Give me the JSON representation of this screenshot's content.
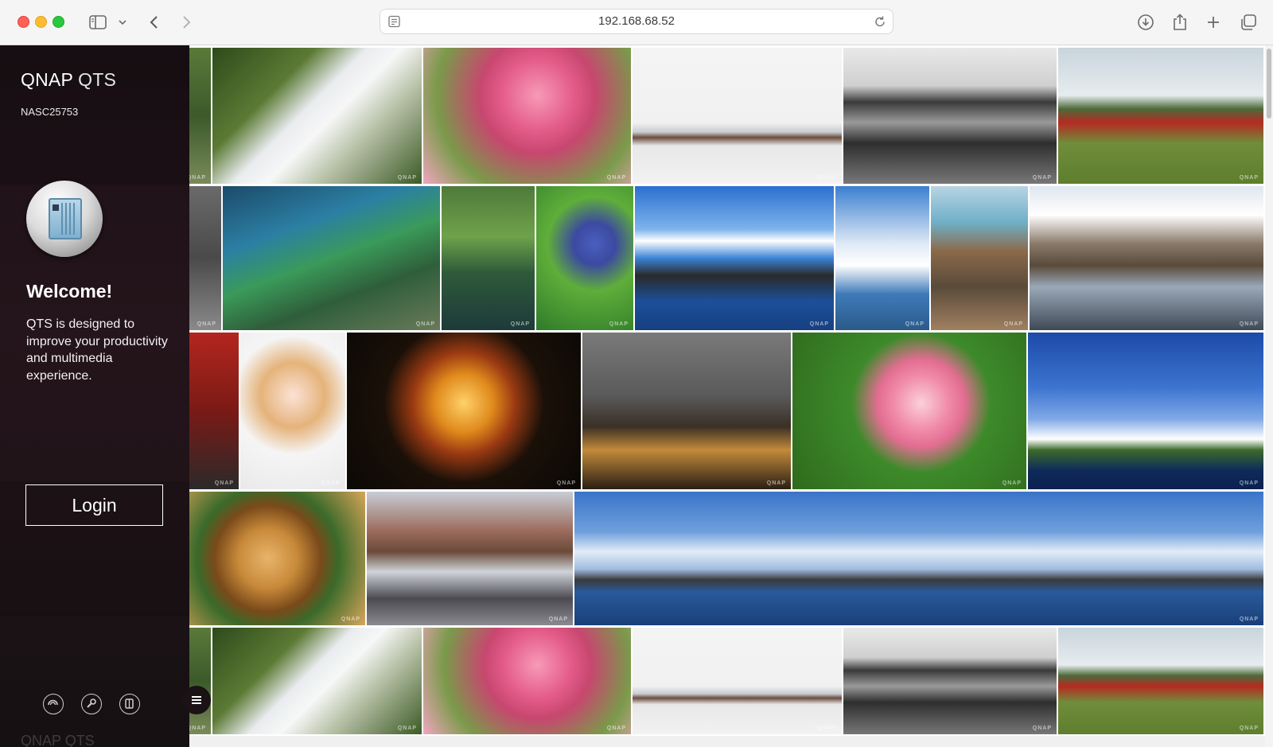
{
  "browser": {
    "url": "192.168.68.52",
    "toolbar_icons": [
      "sidebar-icon",
      "chevron-down-icon",
      "back-icon",
      "forward-icon",
      "site-info-icon",
      "reload-icon",
      "download-icon",
      "share-icon",
      "new-tab-icon",
      "tab-overview-icon"
    ]
  },
  "sidebar": {
    "brand_primary": "QNAP",
    "brand_secondary": "QTS",
    "hostname": "NASC25753",
    "welcome": "Welcome!",
    "description": "QTS is designed to improve your productivity and multimedia experience.",
    "login_label": "Login",
    "footer_icons": [
      "qfinder-icon",
      "helpdesk-icon",
      "myqnapcloud-icon"
    ],
    "bottom_brand": "QNAP QTS"
  },
  "colors": {
    "sidebar_bg": "#1f1418",
    "login_border": "#ffffff",
    "chrome_bg": "#f6f5f5"
  },
  "gallery": {
    "photos": [
      {
        "name": "cyclamen",
        "bg": "linear-gradient(135deg,#2e4a1c 0%,#5c7a34 30%,#e9ecef 45%,#f7f7f7 55%,#b8c2a8 70%,#3c5a25 100%)"
      },
      {
        "name": "cherry-blossom",
        "bg": "radial-gradient(circle at 55% 35%,#f79ab8 0%,#e45c8a 25%,#c7476f 40%,#7a9a4a 70%,#f2a6c0 100%)"
      },
      {
        "name": "foggy-pier",
        "bg": "linear-gradient(180deg,#f4f4f4 0%,#f1f1f1 55%,#c9cdd0 62%,#6b4c3e 66%,#e8e8e8 72%,#f2f2f2 100%)"
      },
      {
        "name": "bw-seascape",
        "bg": "linear-gradient(180deg,#e9e9e9 0%,#cfcfcf 28%,#3a3a3a 40%,#9a9a9a 55%,#2e2e2e 70%,#777 100%)"
      },
      {
        "name": "red-tractor",
        "bg": "linear-gradient(180deg,#c9d4dc 0%,#e6ecef 35%,#4d6a3a 45%,#b52a22 55%,#6f8d3b 70%,#5f7e2e 100%)"
      },
      {
        "name": "heart-fish-weir",
        "bg": "linear-gradient(160deg,#1c4a6a 0%,#2b7fa3 30%,#3a9a5a 50%,#2f5e3a 70%,#6a7a5a 100%)"
      },
      {
        "name": "forest-pond",
        "bg": "linear-gradient(180deg,#4f7a3a 0%,#6ea24a 35%,#2f5a3a 60%,#1d3a3a 100%)"
      },
      {
        "name": "agapanthus",
        "bg": "radial-gradient(circle at 60% 40%,#4a5fbf 0%,#3c4aa0 20%,#5fae3a 45%,#2f7a2a 100%)"
      },
      {
        "name": "water-villas",
        "bg": "linear-gradient(180deg,#2a6fd0 0%,#7fb4ec 30%,#ffffff 38%,#3c84d8 50%,#2a2a2a 62%,#1c4f9a 80%,#174080 100%)"
      },
      {
        "name": "boat-sky",
        "bg": "linear-gradient(180deg,#3a7fd0 0%,#dfe9f5 40%,#ffffff 55%,#3f7ab8 75%,#2a5a8a 100%)"
      },
      {
        "name": "rock-ridges",
        "bg": "linear-gradient(180deg,#b8d4e4 0%,#6fb0c8 25%,#8a6a4a 45%,#5a4a3a 70%,#a08060 100%)"
      },
      {
        "name": "canal-warehouses",
        "bg": "linear-gradient(180deg,#dfe6ef 0%,#ffffff 20%,#8a7a6a 40%,#5a4a3a 55%,#9aa8b8 70%,#3f4a56 100%)"
      },
      {
        "name": "red-car",
        "bg": "linear-gradient(180deg,#b3261e 0%,#7a1a16 50%,#2a2a2a 100%)"
      },
      {
        "name": "ice-cream",
        "bg": "radial-gradient(circle at 50% 40%,#fbe2d6 0%,#e5b37a 30%,#f5f5f5 55%,#e9e9e9 100%)"
      },
      {
        "name": "carousel",
        "bg": "radial-gradient(circle at 50% 45%,#ffd16a 0%,#e08a1c 20%,#9a3a12 35%,#1a1008 55%,#0a0805 100%)"
      },
      {
        "name": "rain-window",
        "bg": "linear-gradient(180deg,#7a7a7a 0%,#5a5a5a 40%,#3a3026 60%,#c28a3a 75%,#2a1e14 100%)"
      },
      {
        "name": "pink-rose",
        "bg": "radial-gradient(circle at 55% 45%,#fbd0dc 0%,#f08aa8 18%,#e36e92 28%,#3d8a2a 45%,#2f6a1c 100%)"
      },
      {
        "name": "cliff-sky",
        "bg": "linear-gradient(180deg,#1c4aa8 0%,#3c74d0 35%,#7fa8e6 55%,#ffffff 68%,#3c6a2a 75%,#0f2a5a 88%,#0a2050 100%)"
      },
      {
        "name": "curry-dish",
        "bg": "radial-gradient(circle at 45% 50%,#e8b46a 0%,#c88a3a 25%,#7a4a1a 45%,#3a6a2a 60%,#d9a55a 100%)"
      },
      {
        "name": "brick-harbor",
        "bg": "linear-gradient(180deg,#c8cdd6 0%,#9a6a5a 30%,#6a4a3a 45%,#d0d4da 60%,#4a4a50 80%,#8a8a90 100%)"
      },
      {
        "name": "panorama-coast",
        "bg": "linear-gradient(180deg,#3a74c8 0%,#6ea0dc 30%,#e2ecf6 45%,#9fbde0 58%,#3a3a3a 66%,#2a5a9a 75%,#1a3f7a 100%)"
      },
      {
        "name": "cyclamen-repeat",
        "bg": "linear-gradient(135deg,#2e4a1c 0%,#5c7a34 30%,#e9ecef 45%,#f7f7f7 55%,#b8c2a8 70%,#3c5a25 100%)"
      },
      {
        "name": "cherry-blossom-repeat",
        "bg": "radial-gradient(circle at 55% 35%,#f79ab8 0%,#e45c8a 25%,#c7476f 40%,#7a9a4a 70%,#f2a6c0 100%)"
      },
      {
        "name": "foggy-pier-repeat",
        "bg": "linear-gradient(180deg,#f4f4f4 0%,#f1f1f1 55%,#c9cdd0 62%,#6b4c3e 66%,#e8e8e8 72%,#f2f2f2 100%)"
      },
      {
        "name": "bw-seascape-repeat",
        "bg": "linear-gradient(180deg,#e9e9e9 0%,#cfcfcf 28%,#3a3a3a 40%,#9a9a9a 55%,#2e2e2e 70%,#777 100%)"
      },
      {
        "name": "red-tractor-repeat",
        "bg": "linear-gradient(180deg,#c9d4dc 0%,#e6ecef 35%,#4d6a3a 45%,#b52a22 55%,#6f8d3b 70%,#5f7e2e 100%)"
      }
    ]
  }
}
